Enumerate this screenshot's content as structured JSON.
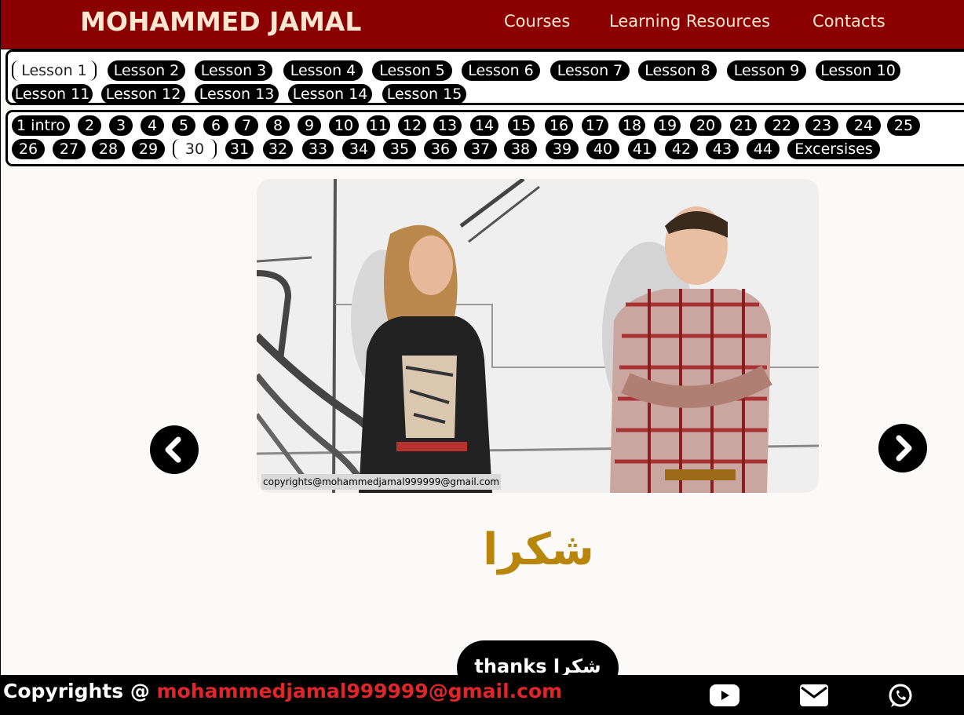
{
  "header": {
    "brand": "MOHAMMED JAMAL",
    "nav": [
      "Courses",
      "Learning Resources",
      "Contacts"
    ]
  },
  "lessons": {
    "active": "Lesson 1",
    "items": [
      "Lesson 1",
      "Lesson 2",
      "Lesson 3",
      "Lesson 4",
      "Lesson 5",
      "Lesson 6",
      "Lesson 7",
      "Lesson 8",
      "Lesson 9",
      "Lesson 10",
      "Lesson 11",
      "Lesson 12",
      "Lesson 13",
      "Lesson 14",
      "Lesson 15"
    ]
  },
  "slides": {
    "active": "30",
    "items": [
      "1 intro",
      "2",
      "3",
      "4",
      "5",
      "6",
      "7",
      "8",
      "9",
      "10",
      "11",
      "12",
      "13",
      "14",
      "15",
      "16",
      "17",
      "18",
      "19",
      "20",
      "21",
      "22",
      "23",
      "24",
      "25",
      "26",
      "27",
      "28",
      "29",
      "30",
      "31",
      "32",
      "33",
      "34",
      "35",
      "36",
      "37",
      "38",
      "39",
      "40",
      "41",
      "42",
      "43",
      "44",
      "Excersises"
    ]
  },
  "slide": {
    "watermark": "copyrights@mohammedjamal999999@gmail.com",
    "word": "شكرا",
    "button_text": "thanks شكرا"
  },
  "footer": {
    "prefix": "Copyrights @ ",
    "email": "mohammedjamal999999@gmail.com",
    "icons": [
      "youtube-icon",
      "mail-icon",
      "whatsapp-icon"
    ]
  },
  "colors": {
    "header_bg": "#8b0000",
    "brand_text": "#fde7d2",
    "word": "#b8860b",
    "footer_email": "#e0262a"
  }
}
